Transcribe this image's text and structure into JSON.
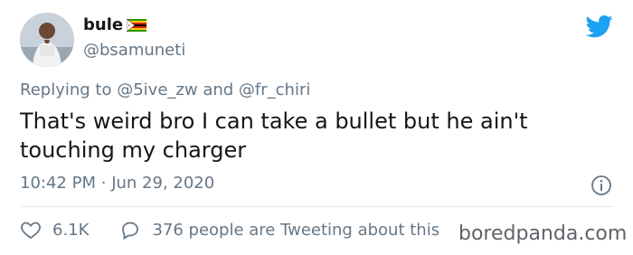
{
  "user": {
    "display_name": "bule",
    "handle": "@bsamuneti"
  },
  "reply": {
    "prefix": "Replying to",
    "mention1": "@5ive_zw",
    "conjunction": "and",
    "mention2": "@fr_chiri"
  },
  "tweet": {
    "text": "That's weird bro I can take a bullet but he ain't touching my charger"
  },
  "meta": {
    "time": "10:42 PM",
    "separator": "·",
    "date": "Jun 29, 2020"
  },
  "actions": {
    "likes": "6.1K",
    "tweeting": "376 people are Tweeting about this"
  },
  "watermark": "boredpanda.com",
  "colors": {
    "brand_blue": "#1da1f2",
    "text_primary": "#14171a",
    "text_secondary": "#657786",
    "divider": "#e1e8ed"
  }
}
